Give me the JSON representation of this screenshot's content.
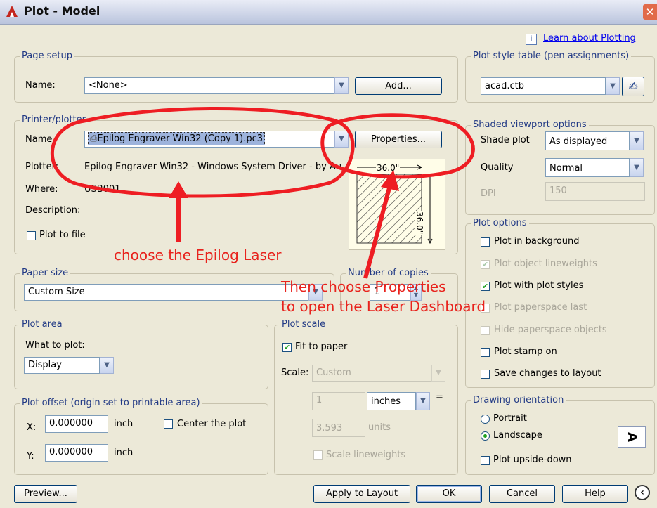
{
  "window": {
    "title": "Plot - Model",
    "close_glyph": "✕"
  },
  "help_link": {
    "icon": "i",
    "label": "Learn about Plotting"
  },
  "page_setup": {
    "legend": "Page setup",
    "name_label": "Name:",
    "name_value": "<None>",
    "add_button": "Add..."
  },
  "printer": {
    "legend": "Printer/plotter",
    "name_label": "Name",
    "name_value": "Epilog Engraver Win32 (Copy 1).pc3",
    "properties_button": "Properties...",
    "plotter_label": "Plotter:",
    "plotter_value": "Epilog Engraver Win32 - Windows System Driver - by Au...",
    "where_label": "Where:",
    "where_value": "USB001",
    "description_label": "Description:",
    "plot_to_file": "Plot to file",
    "preview_width": "36.0\"",
    "preview_height": "36.0\""
  },
  "paper_size": {
    "legend": "Paper size",
    "value": "Custom Size"
  },
  "copies": {
    "legend": "Number of copies",
    "value": "1"
  },
  "plot_area": {
    "legend": "Plot area",
    "what_label": "What to plot:",
    "what_value": "Display"
  },
  "plot_offset": {
    "legend": "Plot offset (origin set to printable area)",
    "x_label": "X:",
    "x_value": "0.000000",
    "x_unit": "inch",
    "y_label": "Y:",
    "y_value": "0.000000",
    "y_unit": "inch",
    "center": "Center the plot"
  },
  "plot_scale": {
    "legend": "Plot scale",
    "fit_to_paper": "Fit to paper",
    "scale_label": "Scale:",
    "scale_value": "Custom",
    "value1": "1",
    "unit1": "inches",
    "equals": "=",
    "value2": "3.593",
    "unit2": "units",
    "scale_lineweights": "Scale lineweights"
  },
  "plot_style_table": {
    "legend": "Plot style table (pen assignments)",
    "value": "acad.ctb"
  },
  "shaded_viewport": {
    "legend": "Shaded viewport options",
    "shade_label": "Shade plot",
    "shade_value": "As displayed",
    "quality_label": "Quality",
    "quality_value": "Normal",
    "dpi_label": "DPI",
    "dpi_value": "150"
  },
  "plot_options": {
    "legend": "Plot options",
    "items": [
      {
        "label": "Plot in background",
        "checked": false,
        "enabled": true
      },
      {
        "label": "Plot object lineweights",
        "checked": true,
        "enabled": false
      },
      {
        "label": "Plot with plot styles",
        "checked": true,
        "enabled": true
      },
      {
        "label": "Plot paperspace last",
        "checked": false,
        "enabled": false
      },
      {
        "label": "Hide paperspace objects",
        "checked": false,
        "enabled": false
      },
      {
        "label": "Plot stamp on",
        "checked": false,
        "enabled": true
      },
      {
        "label": "Save changes to layout",
        "checked": false,
        "enabled": true
      }
    ]
  },
  "orientation": {
    "legend": "Drawing orientation",
    "portrait": "Portrait",
    "landscape": "Landscape",
    "selected": "Landscape",
    "upside_down": "Plot upside-down",
    "preview_glyph": "A"
  },
  "footer": {
    "preview": "Preview...",
    "apply": "Apply to Layout",
    "ok": "OK",
    "cancel": "Cancel",
    "help": "Help"
  },
  "annotations": {
    "note1": "choose the Epilog Laser",
    "note2_line1": "Then choose Properties",
    "note2_line2": "to open the Laser Dashboard",
    "color": "#e8231d"
  }
}
